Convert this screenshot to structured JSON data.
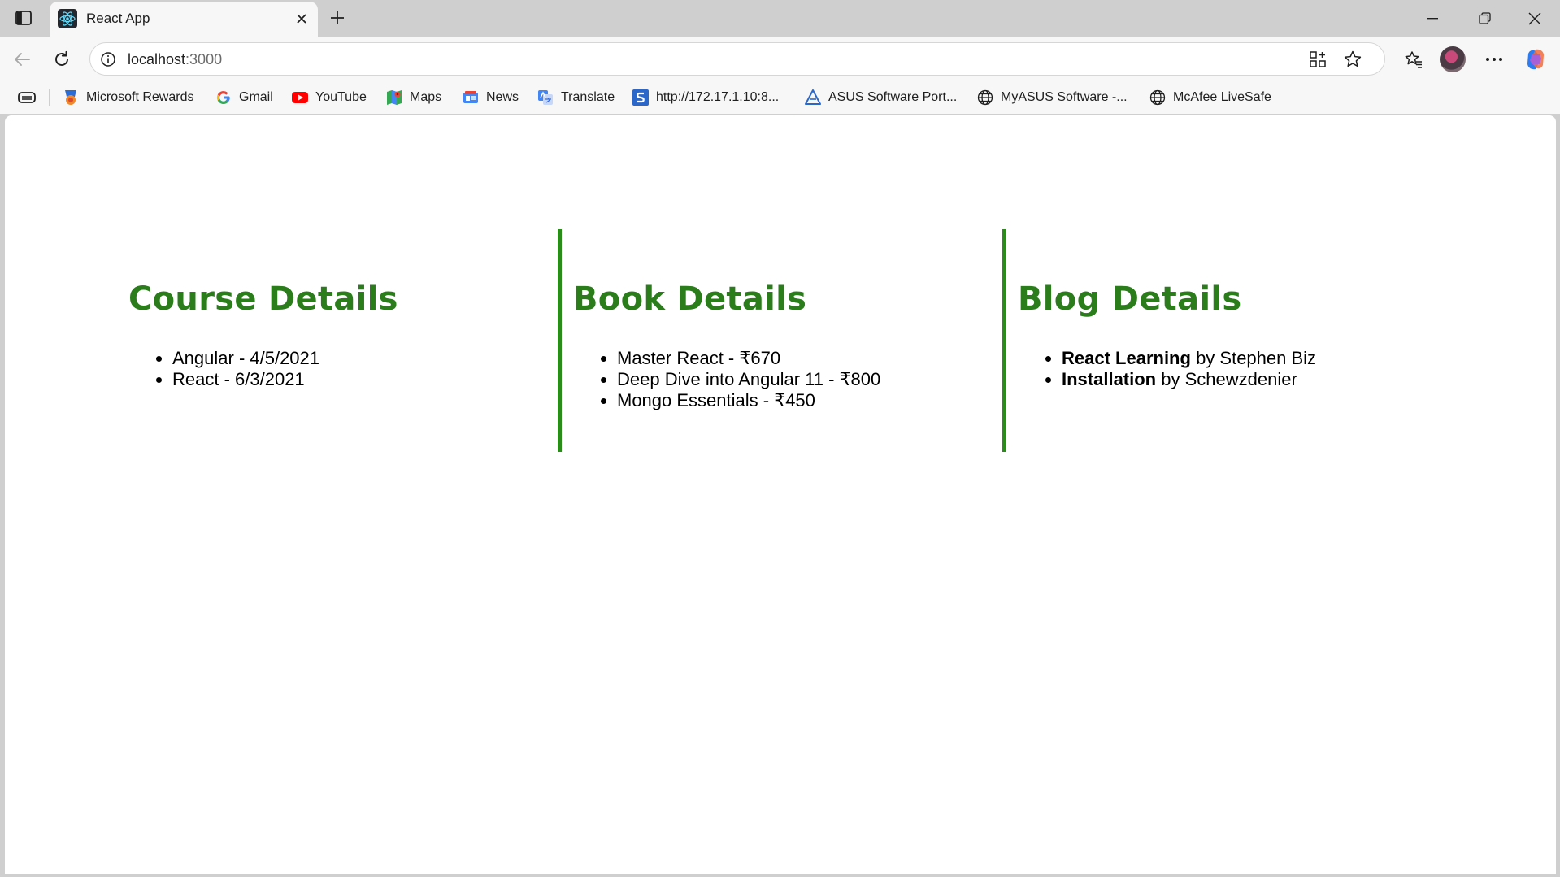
{
  "browser": {
    "tab": {
      "title": "React App",
      "favicon": "react-logo-icon"
    },
    "address": {
      "host": "localhost",
      "port": ":3000"
    },
    "bookmarks": [
      {
        "label": "Microsoft Rewards",
        "icon": "microsoft-rewards-icon"
      },
      {
        "label": "Gmail",
        "icon": "google-icon"
      },
      {
        "label": "YouTube",
        "icon": "youtube-icon"
      },
      {
        "label": "Maps",
        "icon": "maps-icon"
      },
      {
        "label": "News",
        "icon": "news-icon"
      },
      {
        "label": "Translate",
        "icon": "translate-icon"
      },
      {
        "label": "http://172.17.1.10:8...",
        "icon": "s-site-icon"
      },
      {
        "label": "ASUS Software Port...",
        "icon": "asus-icon"
      },
      {
        "label": "MyASUS Software -...",
        "icon": "globe-icon"
      },
      {
        "label": "McAfee LiveSafe",
        "icon": "globe-icon"
      }
    ]
  },
  "page": {
    "accent_color": "#2b8c1b",
    "courses": {
      "heading": "Course Details",
      "items": [
        "Angular - 4/5/2021",
        "React - 6/3/2021"
      ]
    },
    "books": {
      "heading": "Book Details",
      "items": [
        "Master React - ₹670",
        "Deep Dive into Angular 11 - ₹800",
        "Mongo Essentials - ₹450"
      ]
    },
    "blogs": {
      "heading": "Blog Details",
      "items": [
        {
          "title": "React Learning",
          "author": "by Stephen Biz"
        },
        {
          "title": "Installation",
          "author": "by Schewzdenier"
        }
      ]
    }
  }
}
